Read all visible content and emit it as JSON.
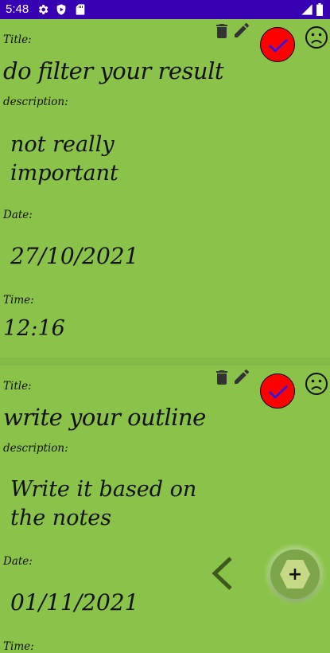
{
  "status_bar": {
    "time": "5:48",
    "icons": [
      "settings-icon",
      "shield-play-icon",
      "sd-card-icon",
      "signal-icon",
      "battery-icon"
    ],
    "background": "#3700b3"
  },
  "theme": {
    "background": "#8bc34a",
    "done_color": "#ff0000",
    "check_color": "#1a1aff"
  },
  "labels": {
    "title": "Title:",
    "description": "description:",
    "date": "Date:",
    "time": "Time:"
  },
  "tasks": [
    {
      "title": "do filter your result",
      "description_lines": [
        "not really",
        "important"
      ],
      "date": "27/10/2021",
      "time": "12:16"
    },
    {
      "title": "write your outline",
      "description_lines": [
        "Write it based on",
        "the notes"
      ],
      "date": "01/11/2021",
      "time": ""
    }
  ],
  "task_actions": [
    "delete-icon",
    "edit-icon",
    "done-check-icon",
    "sad-face-icon"
  ],
  "navigation": {
    "back_icon": "chevron-left-icon"
  },
  "fab": {
    "label": "+",
    "icon": "plus-icon"
  }
}
